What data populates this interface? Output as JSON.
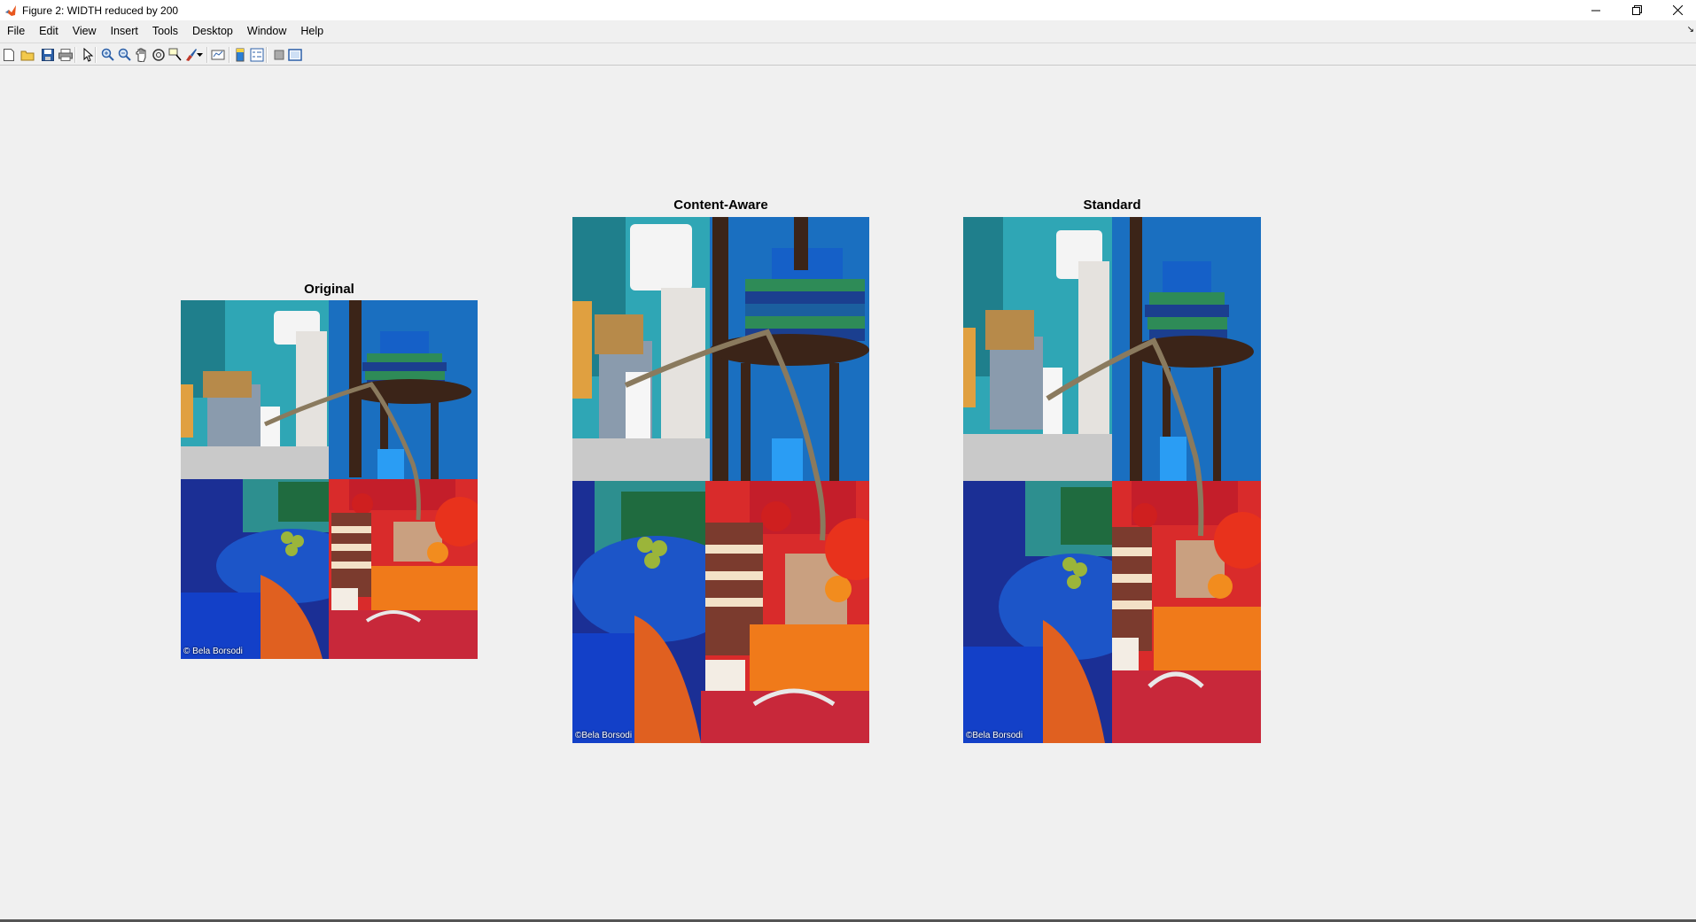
{
  "window": {
    "title": "Figure 2: WIDTH reduced by 200",
    "controls": [
      "minimize",
      "restore",
      "close"
    ]
  },
  "menu": [
    "File",
    "Edit",
    "View",
    "Insert",
    "Tools",
    "Desktop",
    "Window",
    "Help"
  ],
  "toolbar": [
    "new-figure-icon",
    "open-file-icon",
    "save-icon",
    "print-icon",
    "select-arrow-icon",
    "zoom-in-icon",
    "zoom-out-icon",
    "pan-hand-icon",
    "rotate-3d-icon",
    "data-cursor-icon",
    "brush-icon",
    "dropdown-arrow-icon",
    "link-plot-icon",
    "insert-colorbar-icon",
    "insert-legend-icon",
    "hide-plot-tools-icon",
    "show-plot-tools-icon"
  ],
  "figures": [
    {
      "title": "Original",
      "credit": "© Bela Borsodi"
    },
    {
      "title": "Content-Aware",
      "credit": "©Bela Borsodi"
    },
    {
      "title": "Standard",
      "credit": "©Bela Borsodi"
    }
  ],
  "colors": {
    "background": "#f0f0f0",
    "matlab_orange": "#e8571e",
    "panel_teal": "#2fa6b5",
    "panel_blue": "#1a6fc0",
    "panel_navy": "#1b2f95",
    "panel_red": "#d92b2b"
  }
}
